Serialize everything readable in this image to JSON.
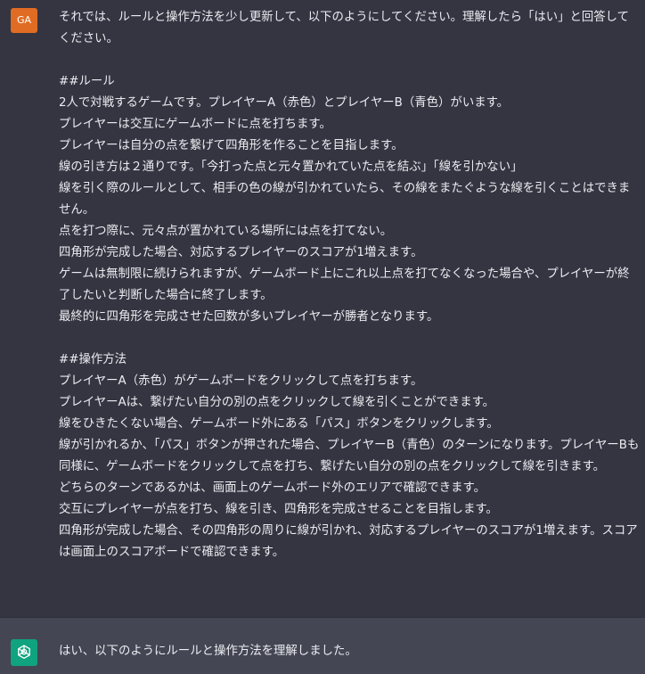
{
  "user": {
    "avatar_initials": "GA",
    "lines": [
      "それでは、ルールと操作方法を少し更新して、以下のようにしてください。理解したら「はい」と回答してください。",
      "",
      "##ルール",
      "2人で対戦するゲームです。プレイヤーA（赤色）とプレイヤーB（青色）がいます。",
      "プレイヤーは交互にゲームボードに点を打ちます。",
      "プレイヤーは自分の点を繋げて四角形を作ることを目指します。",
      "線の引き方は２通りです。「今打った点と元々置かれていた点を結ぶ」「線を引かない」",
      "線を引く際のルールとして、相手の色の線が引かれていたら、その線をまたぐような線を引くことはできません。",
      "点を打つ際に、元々点が置かれている場所には点を打てない。",
      "四角形が完成した場合、対応するプレイヤーのスコアが1増えます。",
      "ゲームは無制限に続けられますが、ゲームボード上にこれ以上点を打てなくなった場合や、プレイヤーが終了したいと判断した場合に終了します。",
      "最終的に四角形を完成させた回数が多いプレイヤーが勝者となります。",
      "",
      "##操作方法",
      "プレイヤーA（赤色）がゲームボードをクリックして点を打ちます。",
      "プレイヤーAは、繋げたい自分の別の点をクリックして線を引くことができます。",
      "線をひきたくない場合、ゲームボード外にある「パス」ボタンをクリックします。",
      "線が引かれるか、「パス」ボタンが押された場合、プレイヤーB（青色）のターンになります。プレイヤーBも同様に、ゲームボードをクリックして点を打ち、繋げたい自分の別の点をクリックして線を引きます。",
      "どちらのターンであるかは、画面上のゲームボード外のエリアで確認できます。",
      "交互にプレイヤーが点を打ち、線を引き、四角形を完成させることを目指します。",
      "四角形が完成した場合、その四角形の周りに線が引かれ、対応するプレイヤーのスコアが1増えます。スコアは画面上のスコアボードで確認できます。"
    ]
  },
  "assistant": {
    "icon": "openai-logo-icon",
    "text": "はい、以下のようにルールと操作方法を理解しました。"
  }
}
